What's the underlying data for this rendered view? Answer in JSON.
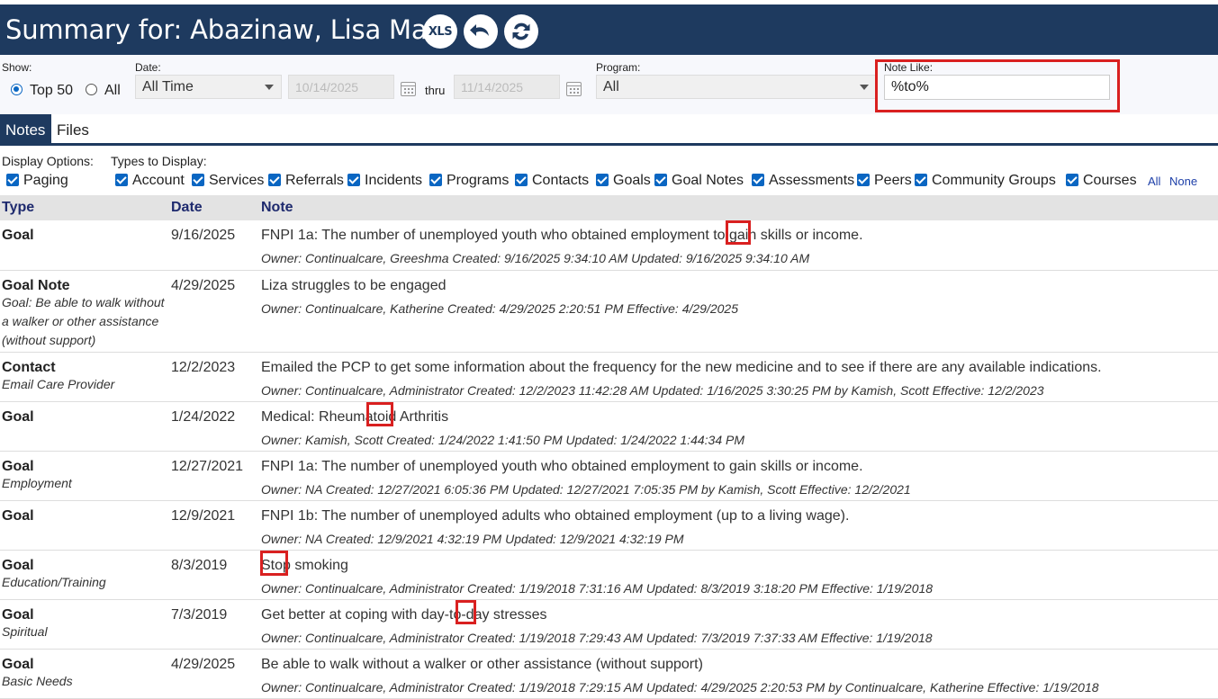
{
  "header": {
    "title": "Summary for: Abazinaw, Lisa Mary",
    "xls_label": "XLS"
  },
  "filters": {
    "show_label": "Show:",
    "show_options": [
      "Top 50",
      "All"
    ],
    "show_selected": "Top 50",
    "date_label": "Date:",
    "date_range": "All Time",
    "date_from": "10/14/2025",
    "thru_label": "thru",
    "date_to": "11/14/2025",
    "program_label": "Program:",
    "program_value": "All",
    "note_like_label": "Note Like:",
    "note_like_value": "%to%"
  },
  "tabs": [
    "Notes",
    "Files"
  ],
  "active_tab": "Notes",
  "display_options": {
    "label": "Display Options:",
    "paging": "Paging",
    "types_label": "Types to Display:",
    "types": [
      "Account",
      "Services",
      "Referrals",
      "Incidents",
      "Programs",
      "Contacts",
      "Goals",
      "Goal Notes",
      "Assessments",
      "Peers",
      "Community Groups",
      "Courses"
    ],
    "all_link": "All",
    "none_link": "None"
  },
  "table": {
    "headers": [
      "Type",
      "Date",
      "Note"
    ],
    "rows": [
      {
        "type": "Goal",
        "sub": "",
        "date": "9/16/2025",
        "note": "FNPI 1a: The number of unemployed youth who obtained employment to gain skills or income.",
        "meta": "Owner: Continualcare, Greeshma Created: 9/16/2025 9:34:10 AM  Updated: 9/16/2025 9:34:10 AM"
      },
      {
        "type": "Goal Note",
        "sub": "Goal: Be able to walk without a walker or other assistance (without support)",
        "date": "4/29/2025",
        "note": "Liza struggles to be engaged",
        "meta": "Owner: Continualcare, Katherine Created: 4/29/2025 2:20:51 PM  Effective: 4/29/2025"
      },
      {
        "type": "Contact",
        "sub": "Email Care Provider",
        "date": "12/2/2023",
        "note": "Emailed the PCP to get some information about the frequency for the new medicine and to see if there are any available indications.",
        "meta": "Owner: Continualcare, Administrator Created: 12/2/2023 11:42:28 AM  Updated: 1/16/2025 3:30:25 PM by Kamish, Scott  Effective: 12/2/2023"
      },
      {
        "type": "Goal",
        "sub": "",
        "date": "1/24/2022",
        "note": "Medical: Rheumatoid Arthritis",
        "meta": "Owner: Kamish, Scott Created: 1/24/2022 1:41:50 PM  Updated: 1/24/2022 1:44:34 PM"
      },
      {
        "type": "Goal",
        "sub": "Employment",
        "date": "12/27/2021",
        "note": "FNPI 1a: The number of unemployed youth who obtained employment to gain skills or income.",
        "meta": "Owner: NA Created: 12/27/2021 6:05:36 PM  Updated: 12/27/2021 7:05:35 PM by Kamish, Scott  Effective: 12/2/2021"
      },
      {
        "type": "Goal",
        "sub": "",
        "date": "12/9/2021",
        "note": "FNPI 1b: The number of unemployed adults who obtained employment (up to a living wage).",
        "meta": "Owner: NA Created: 12/9/2021 4:32:19 PM  Updated: 12/9/2021 4:32:19 PM"
      },
      {
        "type": "Goal",
        "sub": "Education/Training",
        "date": "8/3/2019",
        "note": "Stop smoking",
        "meta": "Owner: Continualcare, Administrator Created: 1/19/2018 7:31:16 AM  Updated: 8/3/2019 3:18:20 PM  Effective: 1/19/2018"
      },
      {
        "type": "Goal",
        "sub": "Spiritual",
        "date": "7/3/2019",
        "note": "Get better at coping with day-to-day stresses",
        "meta": "Owner: Continualcare, Administrator Created: 1/19/2018 7:29:43 AM  Updated: 7/3/2019 7:37:33 AM  Effective: 1/19/2018"
      },
      {
        "type": "Goal",
        "sub": "Basic Needs",
        "date": "4/29/2025",
        "note": "Be able to walk without a walker or other assistance (without support)",
        "meta": "Owner: Continualcare, Administrator Created: 1/19/2018 7:29:15 AM  Updated: 4/29/2025 2:20:53 PM by Continualcare, Katherine  Effective: 1/19/2018"
      }
    ]
  },
  "colors": {
    "header_bg": "#1e3a5f",
    "checkbox": "#0a66c2",
    "highlight_box": "#d92020",
    "table_header_text": "#1e2a6e"
  }
}
